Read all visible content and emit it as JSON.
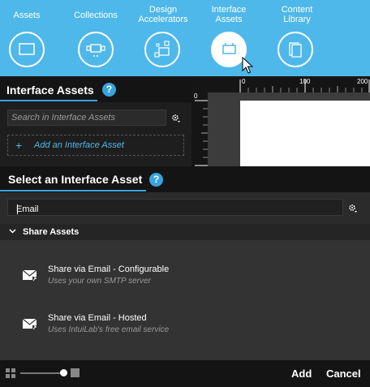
{
  "tabs": [
    {
      "label": "Assets",
      "icon": "rectangle-icon"
    },
    {
      "label": "Collections",
      "icon": "collection-icon"
    },
    {
      "label": "Design\nAccelerators",
      "icon": "accelerators-icon"
    },
    {
      "label": "Interface\nAssets",
      "icon": "interface-assets-icon",
      "active": true
    },
    {
      "label": "Content\nLibrary",
      "icon": "content-library-icon"
    }
  ],
  "upper_panel": {
    "title": "Interface Assets",
    "help": "?",
    "search_placeholder": "Search in Interface Assets",
    "add_label": "Add an Interface Asset",
    "add_plus": "+"
  },
  "ruler": {
    "h_ticks": [
      "0",
      "100",
      "200"
    ],
    "v_ticks": [
      "0"
    ]
  },
  "dialog": {
    "title": "Select an Interface Asset",
    "help": "?",
    "search_value": "Email",
    "group_label": "Share Assets",
    "items": [
      {
        "title": "Share via Email - Configurable",
        "subtitle": "Uses your own SMTP server"
      },
      {
        "title": "Share via Email - Hosted",
        "subtitle": "Uses IntuiLab's free email service"
      }
    ],
    "add_button": "Add",
    "cancel_button": "Cancel"
  },
  "colors": {
    "topbar": "#4fb8ea",
    "accent": "#3aa3de",
    "panel_dark": "#141414"
  }
}
